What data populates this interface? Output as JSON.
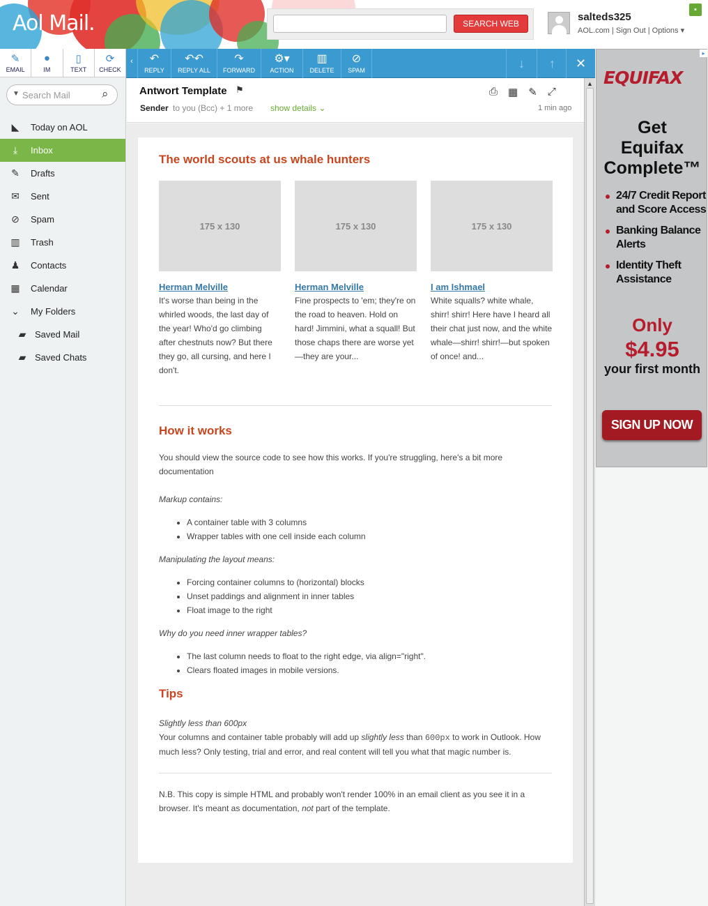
{
  "header": {
    "logo": "Aol Mail.",
    "search_button": "SEARCH WEB",
    "search_value": "",
    "username": "salteds325",
    "links": [
      "AOL.com",
      "Sign Out",
      "Options"
    ]
  },
  "quickbar": [
    {
      "label": "EMAIL",
      "icon": "compose-icon"
    },
    {
      "label": "IM",
      "icon": "chat-bubble-icon"
    },
    {
      "label": "TEXT",
      "icon": "phone-icon"
    },
    {
      "label": "CHECK",
      "icon": "refresh-icon"
    }
  ],
  "search_mail": {
    "placeholder": "Search Mail"
  },
  "nav": [
    {
      "label": "Today on AOL",
      "icon": "aol-icon"
    },
    {
      "label": "Inbox",
      "icon": "inbox-icon",
      "active": true
    },
    {
      "label": "Drafts",
      "icon": "drafts-icon"
    },
    {
      "label": "Sent",
      "icon": "sent-icon"
    },
    {
      "label": "Spam",
      "icon": "spam-icon"
    },
    {
      "label": "Trash",
      "icon": "trash-icon"
    },
    {
      "label": "Contacts",
      "icon": "contacts-icon"
    },
    {
      "label": "Calendar",
      "icon": "calendar-icon"
    },
    {
      "label": "My Folders",
      "icon": "chevron-down-icon"
    },
    {
      "label": "Saved Mail",
      "icon": "folder-icon"
    },
    {
      "label": "Saved Chats",
      "icon": "folder-icon"
    }
  ],
  "toolbar": {
    "buttons": [
      {
        "label": "REPLY",
        "icon": "reply-icon"
      },
      {
        "label": "REPLY ALL",
        "icon": "reply-all-icon"
      },
      {
        "label": "FORWARD",
        "icon": "forward-icon"
      },
      {
        "label": "ACTION",
        "icon": "gear-icon"
      },
      {
        "label": "DELETE",
        "icon": "trash-icon"
      },
      {
        "label": "SPAM",
        "icon": "spam-icon"
      }
    ],
    "accent": "#3b9ad0"
  },
  "mail": {
    "subject": "Antwort Template",
    "sender": "Sender",
    "to": "to you (Bcc) + 1 more",
    "show_details": "show details",
    "time": "1 min ago"
  },
  "content": {
    "heading1": "The world scouts at us whale hunters",
    "columns": [
      {
        "placeholder": "175 x 130",
        "link": "Herman Melville",
        "text": "It's worse than being in the whirled woods, the last day of the year! Who'd go climbing after chestnuts now? But there they go, all cursing, and here I don't."
      },
      {
        "placeholder": "175 x 130",
        "link": "Herman Melville",
        "text": "Fine prospects to 'em; they're on the road to heaven. Hold on hard! Jimmini, what a squall! But those chaps there are worse yet—they are your..."
      },
      {
        "placeholder": "175 x 130",
        "link": "I am Ishmael",
        "text": "White squalls? white whale, shirr! shirr! Here have I heard all their chat just now, and the white whale—shirr! shirr!—but spoken of once! and..."
      }
    ],
    "heading2": "How it works",
    "intro": "You should view the source code to see how this works. If you're struggling, here's a bit more documentation",
    "markup_label": "Markup contains:",
    "markup_items": [
      "A container table with 3 columns",
      "Wrapper tables with one cell inside each column"
    ],
    "layout_label": "Manipulating the layout means:",
    "layout_items": [
      "Forcing container columns to (horizontal) blocks",
      "Unset paddings and alignment in inner tables",
      "Float image to the right"
    ],
    "why_label": "Why do you need inner wrapper tables?",
    "why_items": [
      "The last column needs to float to the right edge, via align=\"right\".",
      "Clears floated images in mobile versions."
    ],
    "heading3": "Tips",
    "tip_title": "Slightly less than 600px",
    "tip_a": "Your columns and container table probably will add up ",
    "tip_b": "slightly less",
    "tip_c": " than ",
    "tip_code": "600px",
    "tip_d": " to work in Outlook. How much less? Only testing, trial and error, and real content will tell you what that magic number is.",
    "nb_a": "N.B. This copy is simple HTML and probably won't render 100% in an email client as you see it in a browser. It's meant as documentation, ",
    "nb_b": "not",
    "nb_c": " part of the template."
  },
  "ad": {
    "logo": "EQUIFAX",
    "title_lines": [
      "Get",
      "Equifax",
      "Complete™"
    ],
    "bullets": [
      "24/7 Credit Report and Score Access",
      "Banking Balance Alerts",
      "Identity Theft Assistance"
    ],
    "only": "Only",
    "price": "$4.95",
    "first": "your first month",
    "cta": "SIGN UP NOW",
    "brand_color": "#b51c2c"
  }
}
